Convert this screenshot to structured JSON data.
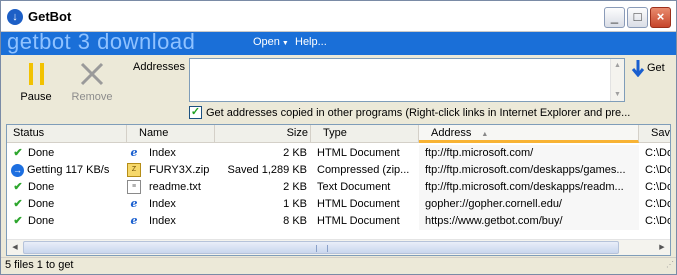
{
  "window": {
    "title": "GetBot",
    "app_icon": "down-arrow-circle-icon"
  },
  "banner": {
    "brand": "getbot 3 download",
    "menu": [
      {
        "label": "Open",
        "has_dropdown": true
      },
      {
        "label": "Help..."
      }
    ]
  },
  "toolbar": {
    "pause_label": "Pause",
    "remove_label": "Remove",
    "addresses_label": "Addresses",
    "addresses_value": "",
    "get_label": "Get"
  },
  "option": {
    "checked": true,
    "label": "Get addresses copied in other programs (Right-click links in Internet Explorer and pre..."
  },
  "table": {
    "columns": [
      "Status",
      "Name",
      "Size",
      "Type",
      "Address",
      "Save"
    ],
    "sorted_column": "Address",
    "rows": [
      {
        "status": "Done",
        "status_icon": "check-icon",
        "name": "Index",
        "file_icon": "ie-icon",
        "size": "2 KB",
        "type": "HTML Document",
        "address": "ftp://ftp.microsoft.com/",
        "save": "C:\\Doc"
      },
      {
        "status": "Getting 117 KB/s",
        "status_icon": "download-icon",
        "name": "FURY3X.zip",
        "file_icon": "zip-icon",
        "size": "Saved 1,289 KB",
        "type": "Compressed (zip...",
        "address": "ftp://ftp.microsoft.com/deskapps/games...",
        "save": "C:\\Doc"
      },
      {
        "status": "Done",
        "status_icon": "check-icon",
        "name": "readme.txt",
        "file_icon": "text-file-icon",
        "size": "2 KB",
        "type": "Text Document",
        "address": "ftp://ftp.microsoft.com/deskapps/readm...",
        "save": "C:\\Doc"
      },
      {
        "status": "Done",
        "status_icon": "check-icon",
        "name": "Index",
        "file_icon": "ie-icon",
        "size": "1 KB",
        "type": "HTML Document",
        "address": "gopher://gopher.cornell.edu/",
        "save": "C:\\Doc"
      },
      {
        "status": "Done",
        "status_icon": "check-icon",
        "name": "Index",
        "file_icon": "ie-icon",
        "size": "8 KB",
        "type": "HTML Document",
        "address": "https://www.getbot.com/buy/",
        "save": "C:\\Doc"
      }
    ]
  },
  "statusbar": {
    "text": "5 files  1 to get"
  },
  "colors": {
    "banner": "#1a6fd8",
    "brand_text": "#8fc2ff",
    "sort_accent": "#f8b334",
    "pause": "#f2c200"
  }
}
